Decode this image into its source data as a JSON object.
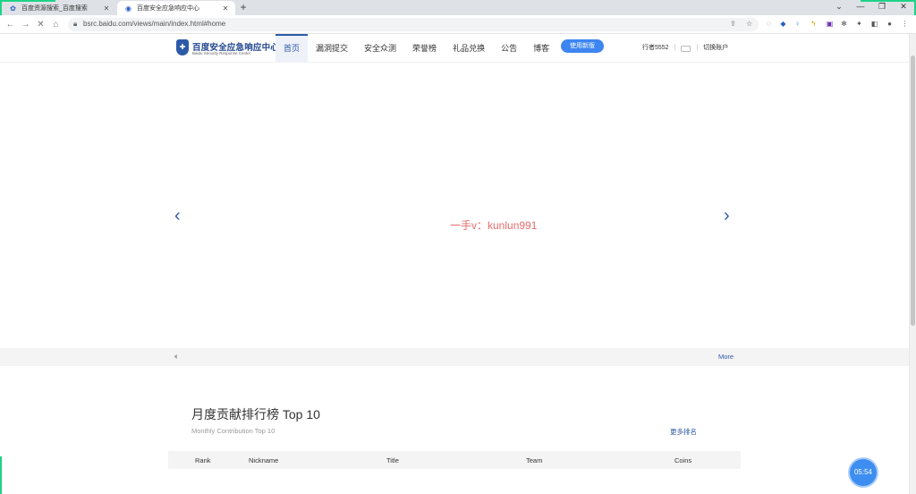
{
  "browser": {
    "tabs": [
      {
        "title": "百度资源搜索_百度搜索",
        "active": false
      },
      {
        "title": "百度安全应急响应中心",
        "active": true
      }
    ],
    "new_tab": "+",
    "window_controls": {
      "chevron": "⌄",
      "minimize": "—",
      "restore": "❐",
      "close": "✕"
    },
    "url": "bsrc.baidu.com/views/main/index.html#home"
  },
  "site": {
    "logo": {
      "title": "百度安全应急响应中心",
      "subtitle": "Baidu Security Response Center"
    },
    "nav": [
      {
        "label": "首页",
        "active": true
      },
      {
        "label": "漏洞提交",
        "active": false
      },
      {
        "label": "安全众测",
        "active": false
      },
      {
        "label": "荣誉榜",
        "active": false
      },
      {
        "label": "礼品兑换",
        "active": false
      },
      {
        "label": "公告",
        "active": false
      },
      {
        "label": "博客",
        "active": false
      }
    ],
    "new_version_button": "使用新版",
    "user": {
      "name": "行者5552",
      "separator": "|",
      "logout": "切换账户"
    },
    "banner": {
      "watermark": "一手v：kunlun991",
      "prev": "‹",
      "next": "›"
    },
    "notice": {
      "more": "More"
    },
    "ranking": {
      "title": "月度贡献排行榜 Top 10",
      "subtitle": "Monthly Contribution Top 10",
      "more": "更多排名",
      "columns": [
        "Rank",
        "Nickname",
        "Title",
        "Team",
        "Coins"
      ]
    },
    "timer": "05:54"
  },
  "colors": {
    "brand": "#2d5aa8",
    "button": "#3d85f0",
    "watermark": "#e96a6a",
    "accent_green": "#1fd286"
  }
}
